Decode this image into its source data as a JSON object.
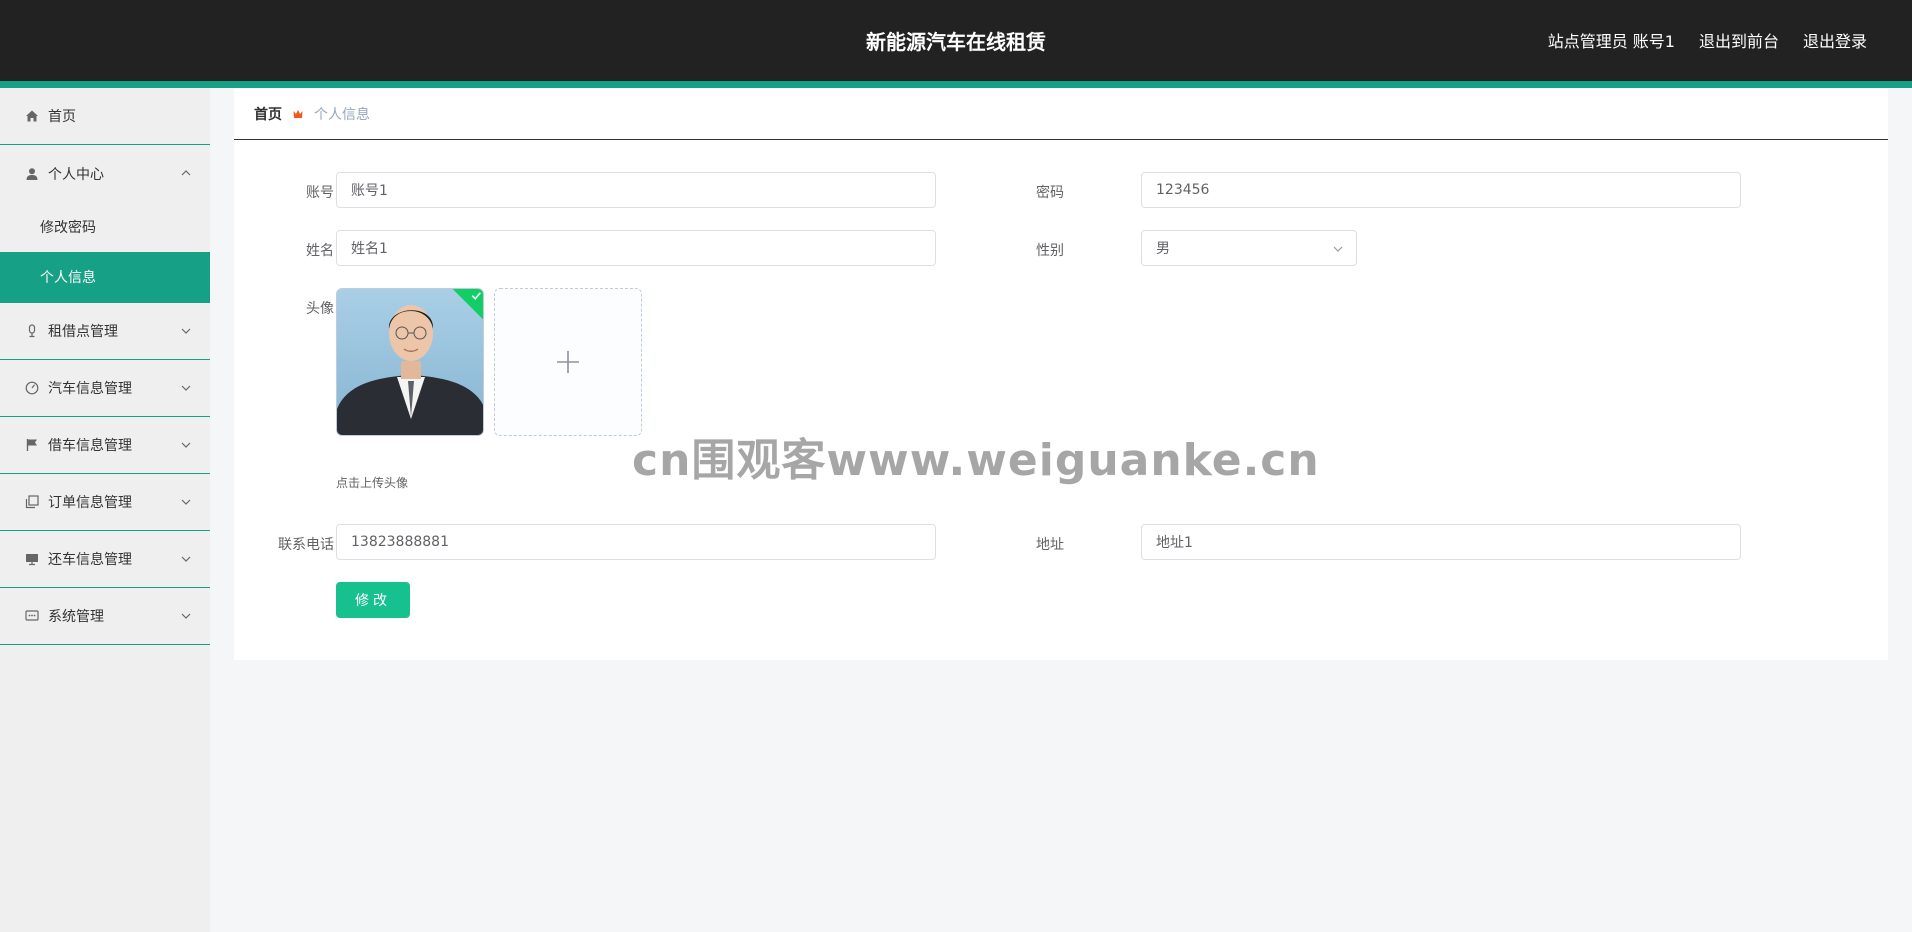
{
  "header": {
    "title": "新能源汽车在线租赁",
    "user_label": "站点管理员 账号1",
    "to_front": "退出到前台",
    "logout": "退出登录"
  },
  "sidebar": {
    "home": "首页",
    "personal_center": "个人中心",
    "change_password": "修改密码",
    "personal_info": "个人信息",
    "rental_points": "租借点管理",
    "car_info": "汽车信息管理",
    "borrow_info": "借车信息管理",
    "order_info": "订单信息管理",
    "return_info": "还车信息管理",
    "system": "系统管理"
  },
  "breadcrumb": {
    "home": "首页",
    "current": "个人信息"
  },
  "form": {
    "account_label": "账号",
    "account_value": "账号1",
    "password_label": "密码",
    "password_value": "123456",
    "name_label": "姓名",
    "name_value": "姓名1",
    "gender_label": "性别",
    "gender_value": "男",
    "avatar_label": "头像",
    "avatar_hint": "点击上传头像",
    "phone_label": "联系电话",
    "phone_value": "13823888881",
    "address_label": "地址",
    "address_value": "地址1",
    "submit_label": "修改"
  },
  "watermark": "cn围观客www.weiguanke.cn",
  "colors": {
    "accent": "#16a085",
    "button": "#16c08f",
    "header_bg": "#222222"
  }
}
